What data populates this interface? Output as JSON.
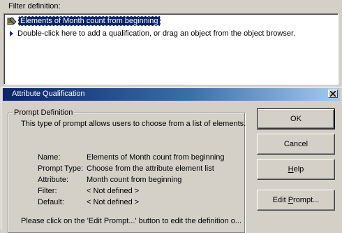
{
  "filter": {
    "label": "Filter definition:",
    "selected_item": "Elements of Month count from beginning",
    "hint": "Double-click here to add a qualification, or drag an object from the object browser."
  },
  "dialog": {
    "title": "Attribute Qualification",
    "group_title": "Prompt Definition",
    "description": "This type of prompt allows users to choose from a list of elements.",
    "fields": [
      {
        "label": "Name:",
        "value": "Elements of Month count from beginning"
      },
      {
        "label": "Prompt Type:",
        "value": "Choose from the attribute element list"
      },
      {
        "label": "Attribute:",
        "value": "Month count from beginning"
      },
      {
        "label": "Filter:",
        "value": "< Not defined >"
      },
      {
        "label": "Default:",
        "value": "< Not defined >"
      }
    ],
    "footer": "Please click on the 'Edit Prompt...' button to edit the definition o...",
    "buttons": {
      "ok": "OK",
      "cancel": "Cancel",
      "help_prefix": "H",
      "help_rest": "elp",
      "edit_prefix": "Edit ",
      "edit_underline": "P",
      "edit_rest": "rompt..."
    }
  },
  "colors": {
    "titlebar_start": "#0a246a",
    "titlebar_end": "#a6caf0",
    "selection": "#0a246a",
    "face": "#d4d0c8"
  }
}
